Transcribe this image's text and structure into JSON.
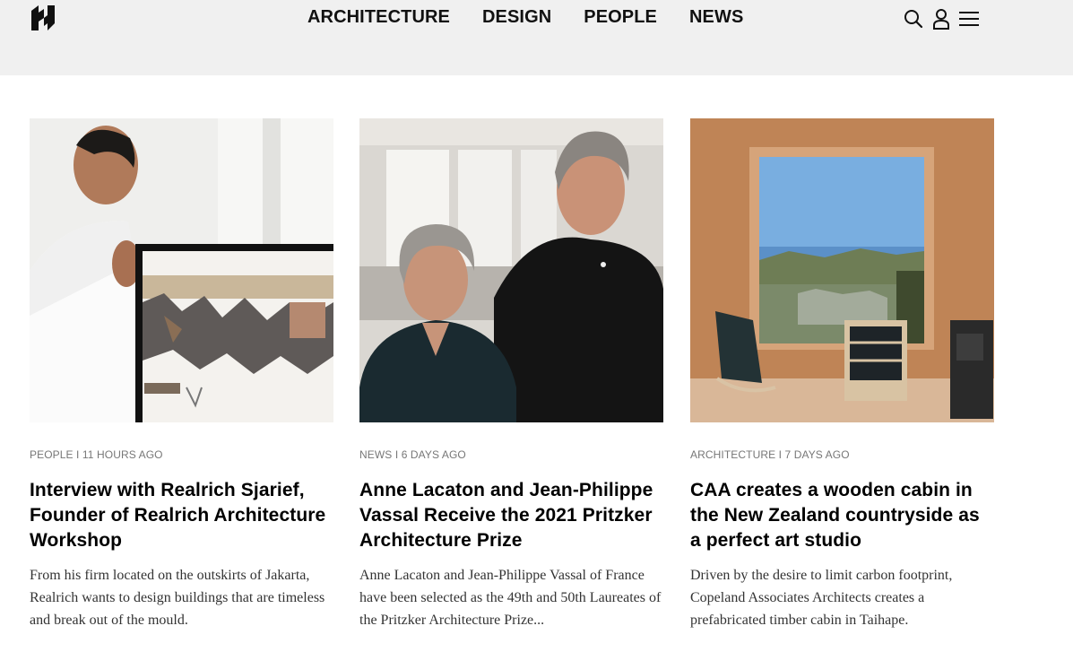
{
  "nav": {
    "items": [
      "ARCHITECTURE",
      "DESIGN",
      "PEOPLE",
      "NEWS"
    ]
  },
  "icons": {
    "logo": "logo-mark",
    "search": "search-icon",
    "account": "user-icon",
    "menu": "hamburger-menu-icon"
  },
  "articles": [
    {
      "category": "PEOPLE",
      "time": "11 HOURS AGO",
      "meta": "PEOPLE I 11 HOURS AGO",
      "title": "Interview with Realrich Sjarief, Founder of Realrich Architecture Workshop",
      "excerpt": "From his firm located on the outskirts of Jakarta, Realrich wants to design buildings that are timeless and break out of the mould."
    },
    {
      "category": "NEWS",
      "time": "6 DAYS AGO",
      "meta": "NEWS I 6 DAYS AGO",
      "title": "Anne Lacaton and Jean-Philippe Vassal Receive the 2021 Pritzker Architecture Prize",
      "excerpt": "Anne Lacaton and Jean-Philippe Vassal of France have been selected as the 49th and 50th Laureates of the Pritzker Architecture Prize..."
    },
    {
      "category": "ARCHITECTURE",
      "time": "7 DAYS AGO",
      "meta": "ARCHITECTURE I 7 DAYS AGO",
      "title": "CAA creates a wooden cabin in the New Zealand countryside as a perfect art studio",
      "excerpt": "Driven by the desire to limit carbon footprint, Copeland Associates Architects creates a prefabricated timber cabin in Taihape."
    }
  ]
}
